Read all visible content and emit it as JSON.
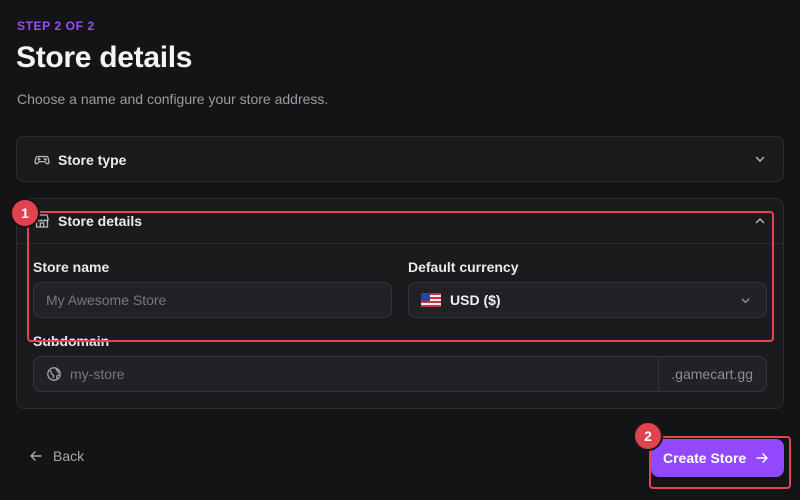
{
  "header": {
    "step": "STEP 2 OF 2",
    "title": "Store details",
    "subtitle": "Choose a name and configure your store address."
  },
  "sections": {
    "store_type": {
      "title": "Store type",
      "icon": "gamepad-icon",
      "state": "collapsed"
    },
    "store_details": {
      "title": "Store details",
      "icon": "storefront-icon",
      "state": "expanded"
    }
  },
  "form": {
    "store_name": {
      "label": "Store name",
      "placeholder": "My Awesome Store",
      "value": ""
    },
    "currency": {
      "label": "Default currency",
      "value": "USD ($)",
      "flag": "us-flag-icon"
    },
    "subdomain": {
      "label": "Subdomain",
      "placeholder": "my-store",
      "value": "",
      "suffix": ".gamecart.gg",
      "icon": "globe-icon"
    }
  },
  "footer": {
    "back_label": "Back",
    "create_label": "Create Store"
  },
  "annotations": [
    {
      "number": "1"
    },
    {
      "number": "2"
    }
  ],
  "colors": {
    "background": "#141416",
    "accent": "#9148ff",
    "step": "#9a4dff",
    "highlight": "#e2454f"
  }
}
